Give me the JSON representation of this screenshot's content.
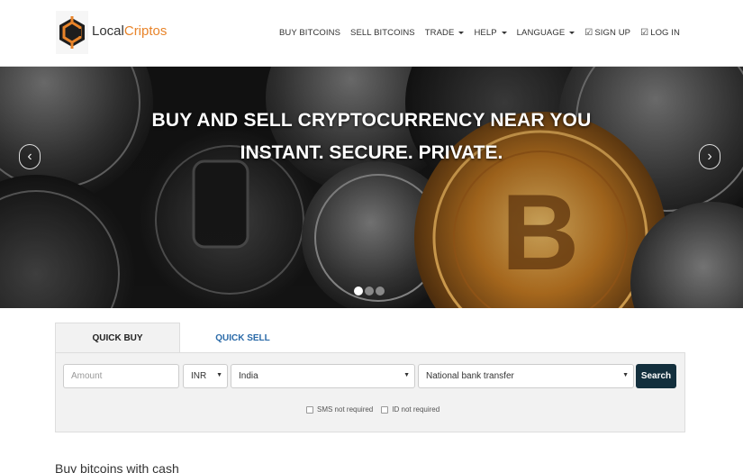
{
  "brand": {
    "name_part1": "Local",
    "name_part2": "Criptos",
    "accent_color": "#e8842a",
    "dark_color": "#1d1d1d"
  },
  "nav": {
    "items": [
      {
        "label": "BUY BITCOINS",
        "dropdown": false,
        "check": false
      },
      {
        "label": "SELL BITCOINS",
        "dropdown": false,
        "check": false
      },
      {
        "label": "TRADE",
        "dropdown": true,
        "check": false
      },
      {
        "label": "HELP",
        "dropdown": true,
        "check": false
      },
      {
        "label": "LANGUAGE",
        "dropdown": true,
        "check": false
      },
      {
        "label": "SIGN UP",
        "dropdown": false,
        "check": true
      },
      {
        "label": "LOG IN",
        "dropdown": false,
        "check": true
      }
    ]
  },
  "hero": {
    "title": "BUY AND SELL CRYPTOCURRENCY NEAR YOU",
    "subtitle": "INSTANT. SECURE. PRIVATE.",
    "prev_icon": "chevron-left-icon",
    "next_icon": "chevron-right-icon",
    "slide_count": 3,
    "active_slide": 1
  },
  "quick": {
    "tabs": [
      {
        "label": "QUICK BUY",
        "active": true
      },
      {
        "label": "QUICK SELL",
        "active": false
      }
    ],
    "amount_placeholder": "Amount",
    "currency": "INR",
    "country": "India",
    "payment_method": "National bank transfer",
    "search_label": "Search",
    "search_color": "#132f3d",
    "checkboxes": [
      {
        "label": "SMS not required",
        "checked": false
      },
      {
        "label": "ID not required",
        "checked": false
      }
    ]
  },
  "section": {
    "title": "Buy bitcoins with cash"
  }
}
